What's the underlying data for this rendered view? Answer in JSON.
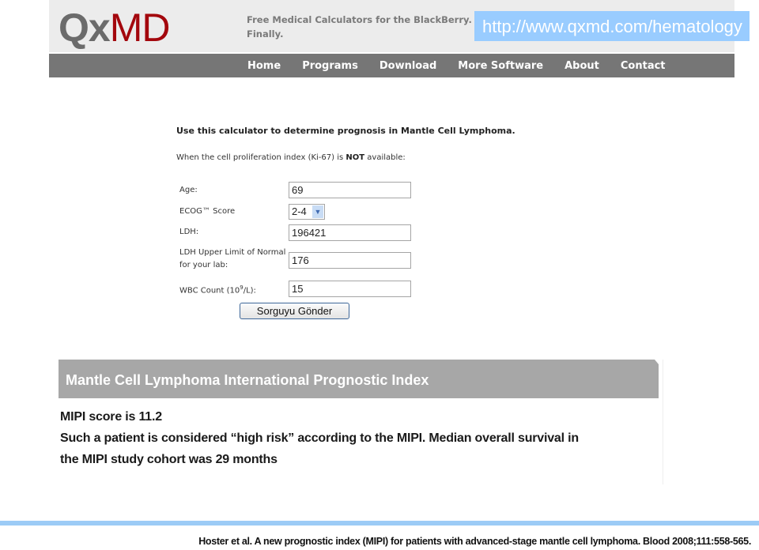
{
  "header": {
    "logo_part1": "Qx",
    "logo_part2": "MD",
    "tagline_line1": "Free Medical Calculators for the BlackBerry.",
    "tagline_line2": "Finally.",
    "url": "http://www.qxmd.com/hematology"
  },
  "nav": {
    "items": [
      "Home",
      "Programs",
      "Download",
      "More Software",
      "About",
      "Contact"
    ]
  },
  "calculator": {
    "intro": "Use this calculator to determine prognosis in Mantle Cell Lymphoma.",
    "subintro_before": "When the cell proliferation index (Ki-67) is ",
    "subintro_bold": "NOT",
    "subintro_after": " available:",
    "fields": {
      "age": {
        "label": "Age:",
        "value": "69"
      },
      "ecog": {
        "label": "ECOG™ Score",
        "value": "2-4"
      },
      "ldh": {
        "label": "LDH:",
        "value": "196421"
      },
      "ldh_uln": {
        "label_line1": "LDH Upper Limit of Normal",
        "label_line2": "for your lab:",
        "value": "176"
      },
      "wbc": {
        "label_prefix": "WBC Count (10",
        "label_sup": "9",
        "label_suffix": "/L):",
        "value": "15"
      }
    },
    "submit_label": "Sorguyu Gönder",
    "dropdown_icon": "chevron-down-icon"
  },
  "result": {
    "title": "Mantle Cell Lymphoma International Prognostic Index",
    "score_line": "MIPI score is 11.2",
    "line2": "Such a patient is considered “high risk” according to the MIPI. Median overall survival in",
    "line3": "the MIPI study cohort was 29 months"
  },
  "citation": "Hoster et al. A new prognostic index (MIPI) for patients with advanced-stage mantle cell lymphoma. Blood 2008;111:558-565.",
  "colors": {
    "brand_red": "#a3070d",
    "logo_gray": "#6b6b6b",
    "nav_bg": "#767676",
    "url_bg": "#99ccff",
    "result_header_bg": "#a7a7a7",
    "divider": "#9ccbf6"
  }
}
